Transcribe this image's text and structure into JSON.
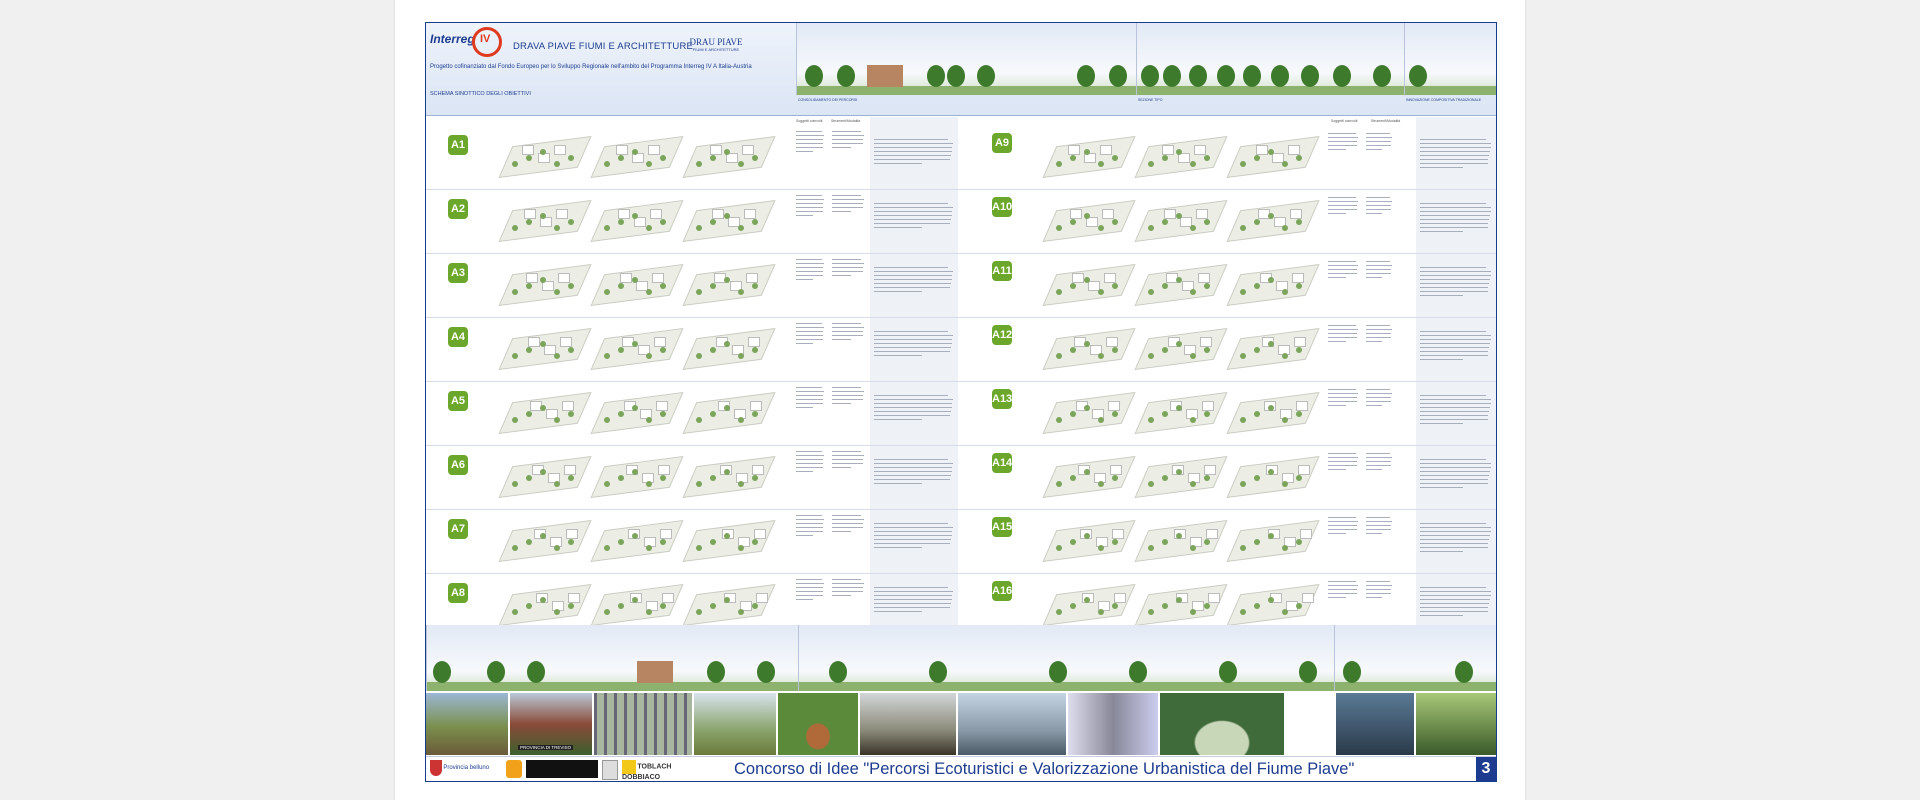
{
  "header": {
    "logo_text": "Interreg",
    "logo_roman": "IV",
    "title": "DRAVA PIAVE FIUMI E ARCHITETTURE",
    "subtitle": "Progetto cofinanziato dal Fondo Europeo per lo Sviluppo Regionale nell'ambito del Programma Interreg IV A Italia-Austria",
    "partner_logo": "DRAU PIAVE",
    "partner_logo_small": "FIUMI E ARCHITETTURE",
    "schema_label": "SCHEMA SINOTTICO DEGLI OBIETTIVI"
  },
  "banner_labels": [
    "CONSOLIDAMENTO DEI PERCORSI",
    "SEZIONE TIPO",
    "INNOVAZIONE COMPOSITIVA TRADIZIONALE"
  ],
  "left_badges": [
    "A1",
    "A2",
    "A3",
    "A4",
    "A5",
    "A6",
    "A7",
    "A8"
  ],
  "right_badges": [
    "A9",
    "A10",
    "A11",
    "A12",
    "A13",
    "A14",
    "A15",
    "A16"
  ],
  "columns": {
    "soggetti": "Soggetti coinvolti",
    "strumenti": "Strumenti/Modalità"
  },
  "photo_labels": [
    "PROVINCIA DI TREVISO"
  ],
  "footer": {
    "logo_belluno": "Provincia belluno",
    "logo_toblach": "TOBLACH DOBBIACO",
    "title": "Concorso di Idee \"Percorsi Ecoturistici e Valorizzazione Urbanistica del Fiume Piave\"",
    "page_number": "3"
  },
  "colors": {
    "brand_blue": "#1d3c8f",
    "badge_green": "#6aa72a",
    "interreg_red": "#e03a1e"
  }
}
